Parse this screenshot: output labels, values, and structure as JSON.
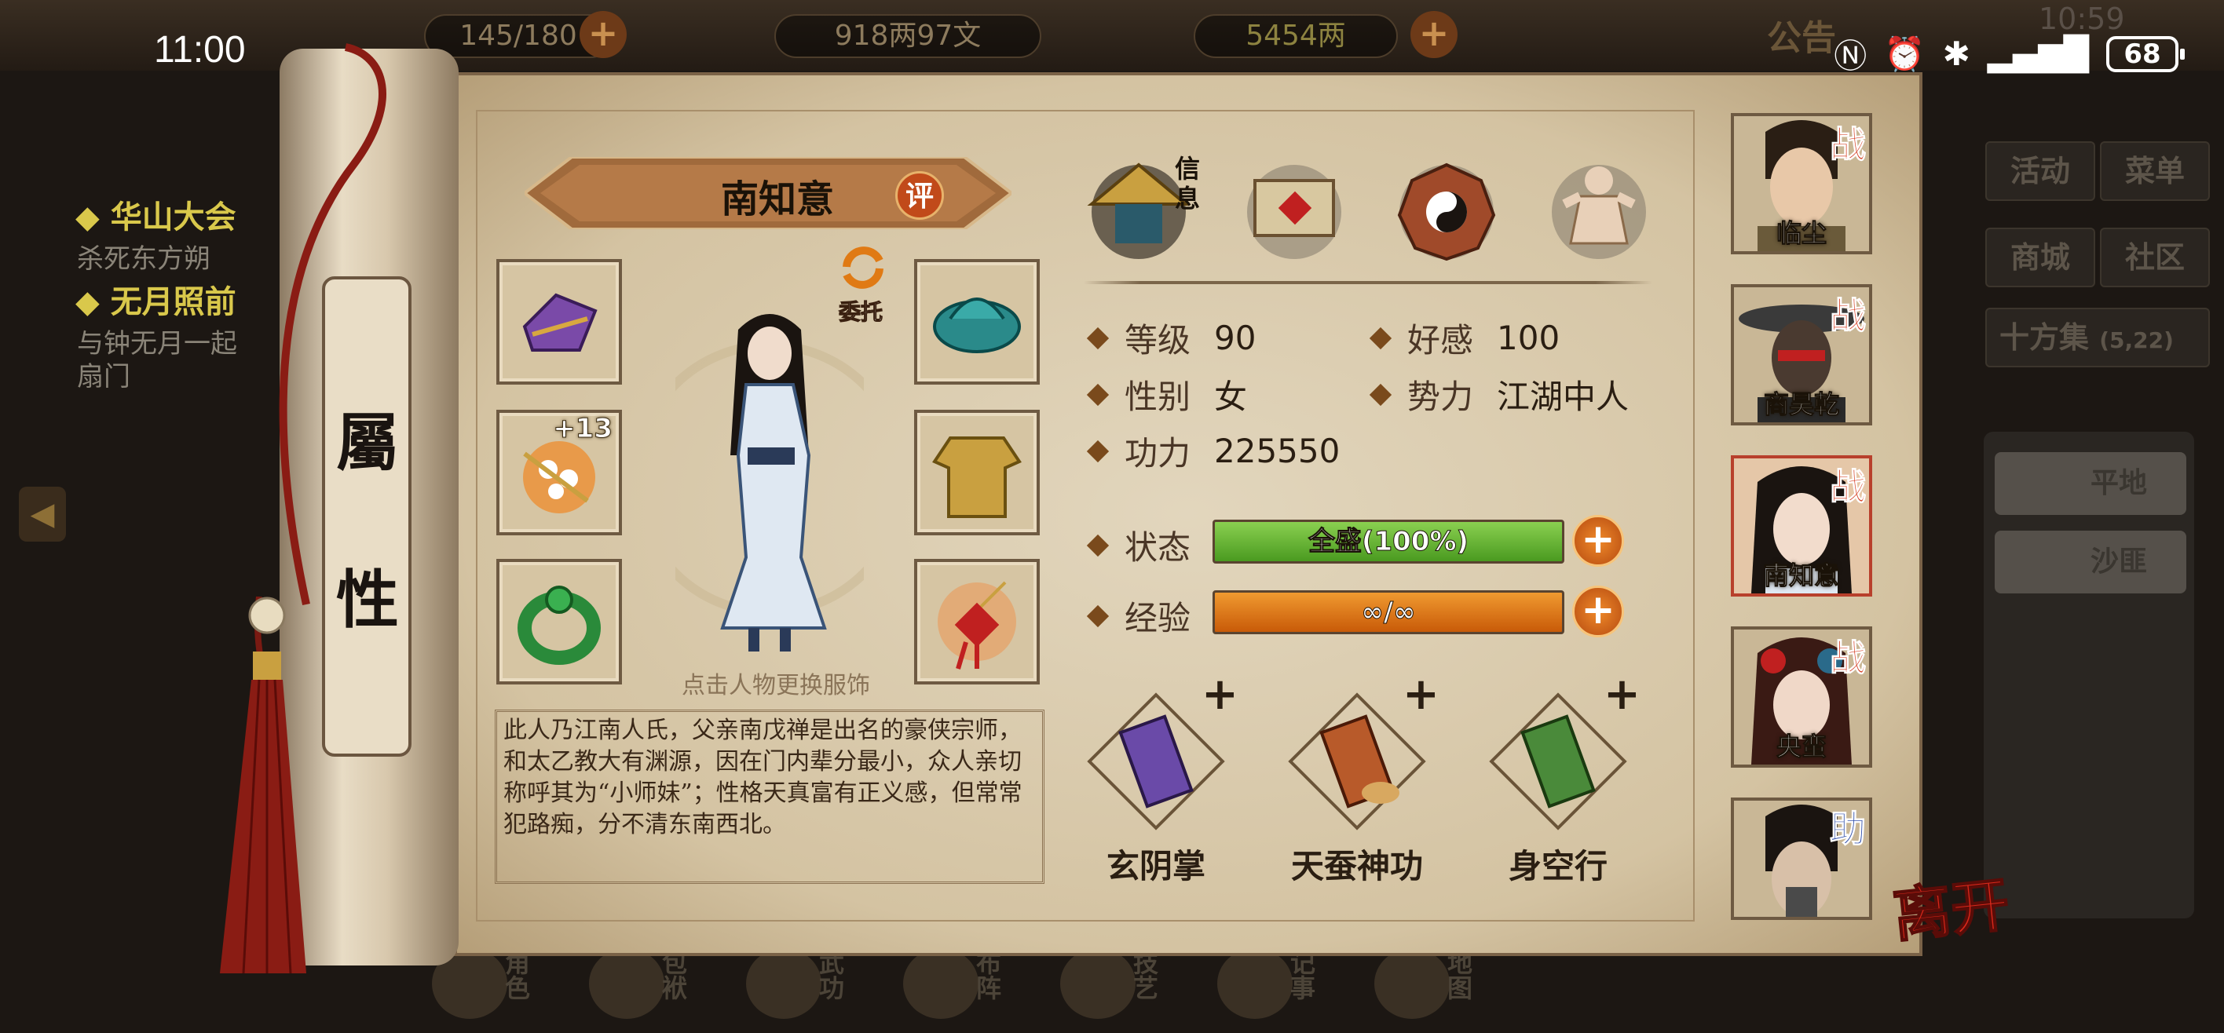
{
  "status_bar": {
    "time": "11:00",
    "battery": "68"
  },
  "top_bar": {
    "stamina": "145/180",
    "coins": "918两97文",
    "ingots": "5454两",
    "notice_label": "公告",
    "dim_time": "10:59"
  },
  "quests": [
    {
      "title": "华山大会",
      "desc": "杀死东方朔"
    },
    {
      "title": "无月照前",
      "desc": "与钟无月一起"
    },
    {
      "title": "",
      "desc": "扇门"
    }
  ],
  "right_menu": {
    "activity": "活动",
    "menu": "菜单",
    "shop": "商城",
    "community": "社区",
    "market": "十方集",
    "market_coords": "(5,22)",
    "plain": "平地",
    "desert": "沙匪"
  },
  "scroll_title": [
    "屬",
    "性"
  ],
  "character": {
    "name": "南知意",
    "eval_label": "评",
    "delegate_label": "委托",
    "change_outfit_hint": "点击人物更换服饰",
    "bio": "此人乃江南人氏，父亲南戊禅是出名的豪侠宗师，和太乙教大有渊源，因在门内辈分最小，众人亲切称呼其为“小师妹”；性格天真富有正义感，但常常犯路痴，分不清东南西北。",
    "equip_badge": "+13"
  },
  "tabs": {
    "info_label": "信息"
  },
  "stats": {
    "level_label": "等级",
    "level": "90",
    "favor_label": "好感",
    "favor": "100",
    "gender_label": "性别",
    "gender": "女",
    "faction_label": "势力",
    "faction": "江湖中人",
    "power_label": "功力",
    "power": "225550",
    "state_label": "状态",
    "state": "全盛(100%)",
    "state_fill": 1.0,
    "exp_label": "经验",
    "exp": "∞/∞",
    "exp_fill": 1.0
  },
  "skills": [
    {
      "name": "玄阴掌",
      "plus": "+"
    },
    {
      "name": "天蚕神功",
      "plus": "+"
    },
    {
      "name": "身空行",
      "plus": "+"
    }
  ],
  "party": [
    {
      "name": "临尘",
      "tag": "战"
    },
    {
      "name": "商昊乾",
      "tag": "战"
    },
    {
      "name": "南知意",
      "tag": "战"
    },
    {
      "name": "央蛮",
      "tag": "战"
    },
    {
      "name": "",
      "tag": "助"
    }
  ],
  "leave_label": "离开",
  "bottom_nav": [
    "角色",
    "包袱",
    "武功",
    "布阵",
    "技艺",
    "记事",
    "地图"
  ],
  "colors": {
    "state_bar": "#5cb030",
    "exp_bar": "#e07a14",
    "accent_red": "#d8281a"
  }
}
